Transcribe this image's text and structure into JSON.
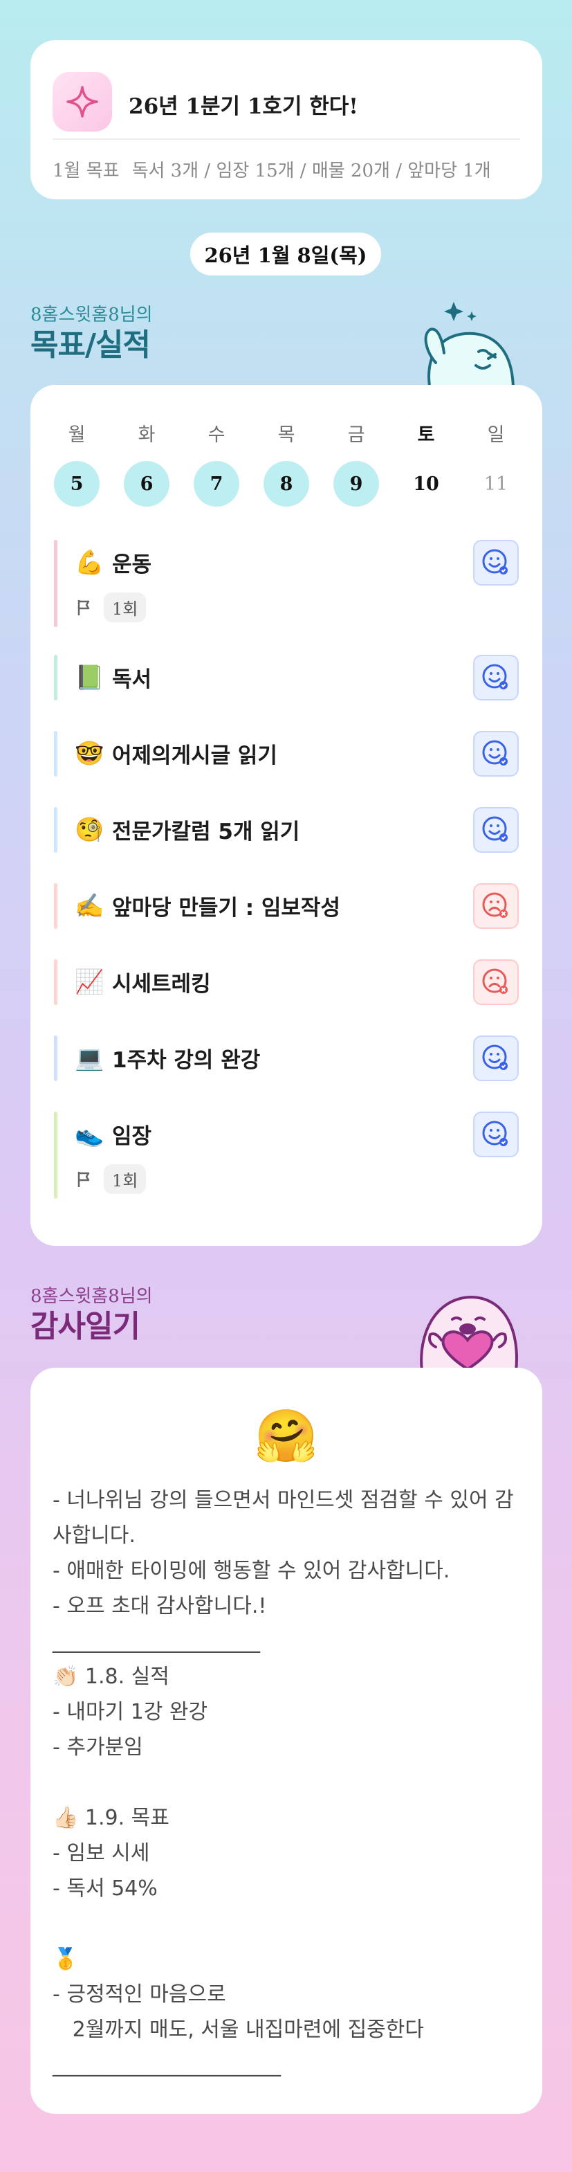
{
  "goal": {
    "title": "26년 1분기 1호기 한다!",
    "label": "1월 목표",
    "detail": "독서 3개 / 임장 15개 / 매물 20개 / 앞마당 1개"
  },
  "date_pill": "26년 1월 8일(목)",
  "activities_section": {
    "subtitle": "8홈스윗홈8님의",
    "title": "목표/실적"
  },
  "week": {
    "days": [
      "월",
      "화",
      "수",
      "목",
      "금",
      "토",
      "일"
    ],
    "dates": [
      "5",
      "6",
      "7",
      "8",
      "9",
      "10",
      "11"
    ]
  },
  "activities": [
    {
      "emoji": "💪",
      "name": "운동",
      "count": "1회",
      "status": "done",
      "bar_color": "#f7c8dc"
    },
    {
      "emoji": "📗",
      "name": "독서",
      "count": "",
      "status": "done",
      "bar_color": "#bfeee0"
    },
    {
      "emoji": "🤓",
      "name": "어제의게시글 읽기",
      "count": "",
      "status": "done",
      "bar_color": "#cfe6ff"
    },
    {
      "emoji": "🧐",
      "name": "전문가칼럼 5개 읽기",
      "count": "",
      "status": "done",
      "bar_color": "#cfe6ff"
    },
    {
      "emoji": "✍️",
      "name": "앞마당 만들기 : 임보작성",
      "count": "",
      "status": "missed",
      "bar_color": "#ffd3cf"
    },
    {
      "emoji": "📈",
      "name": "시세트레킹",
      "count": "",
      "status": "missed",
      "bar_color": "#ffd3cf"
    },
    {
      "emoji": "💻",
      "name": "1주차 강의 완강",
      "count": "",
      "status": "done",
      "bar_color": "#cfe0f7"
    },
    {
      "emoji": "👟",
      "name": "임장",
      "count": "1회",
      "status": "done",
      "bar_color": "#d8efb8"
    }
  ],
  "gratitude_section": {
    "subtitle": "8홈스윗홈8님의",
    "title": "감사일기"
  },
  "gratitude": {
    "emoji": "🤗",
    "text": "- 너나위님 강의 들으면서 마인드셋 점검할 수 있어 감사합니다.\n- 애매한 타이밍에 행동할 수 있어 감사합니다.\n- 오프 초대 감사합니다.!\n____________________\n👏🏻 1.8. 실적\n- 내마기 1강 완강\n- 추가분임\n\n👍🏻 1.9. 목표\n- 임보 시세\n- 독서 54%\n\n🥇\n- 긍정적인 마음으로\n   2월까지 매도, 서울 내집마련에 집중한다\n______________________"
  },
  "colors": {
    "accent_teal": "#1e6e80",
    "accent_purple": "#7a2a78",
    "done_circle": "#bdeff2",
    "status_good": "#3a62e8",
    "status_bad": "#e85a5a"
  }
}
